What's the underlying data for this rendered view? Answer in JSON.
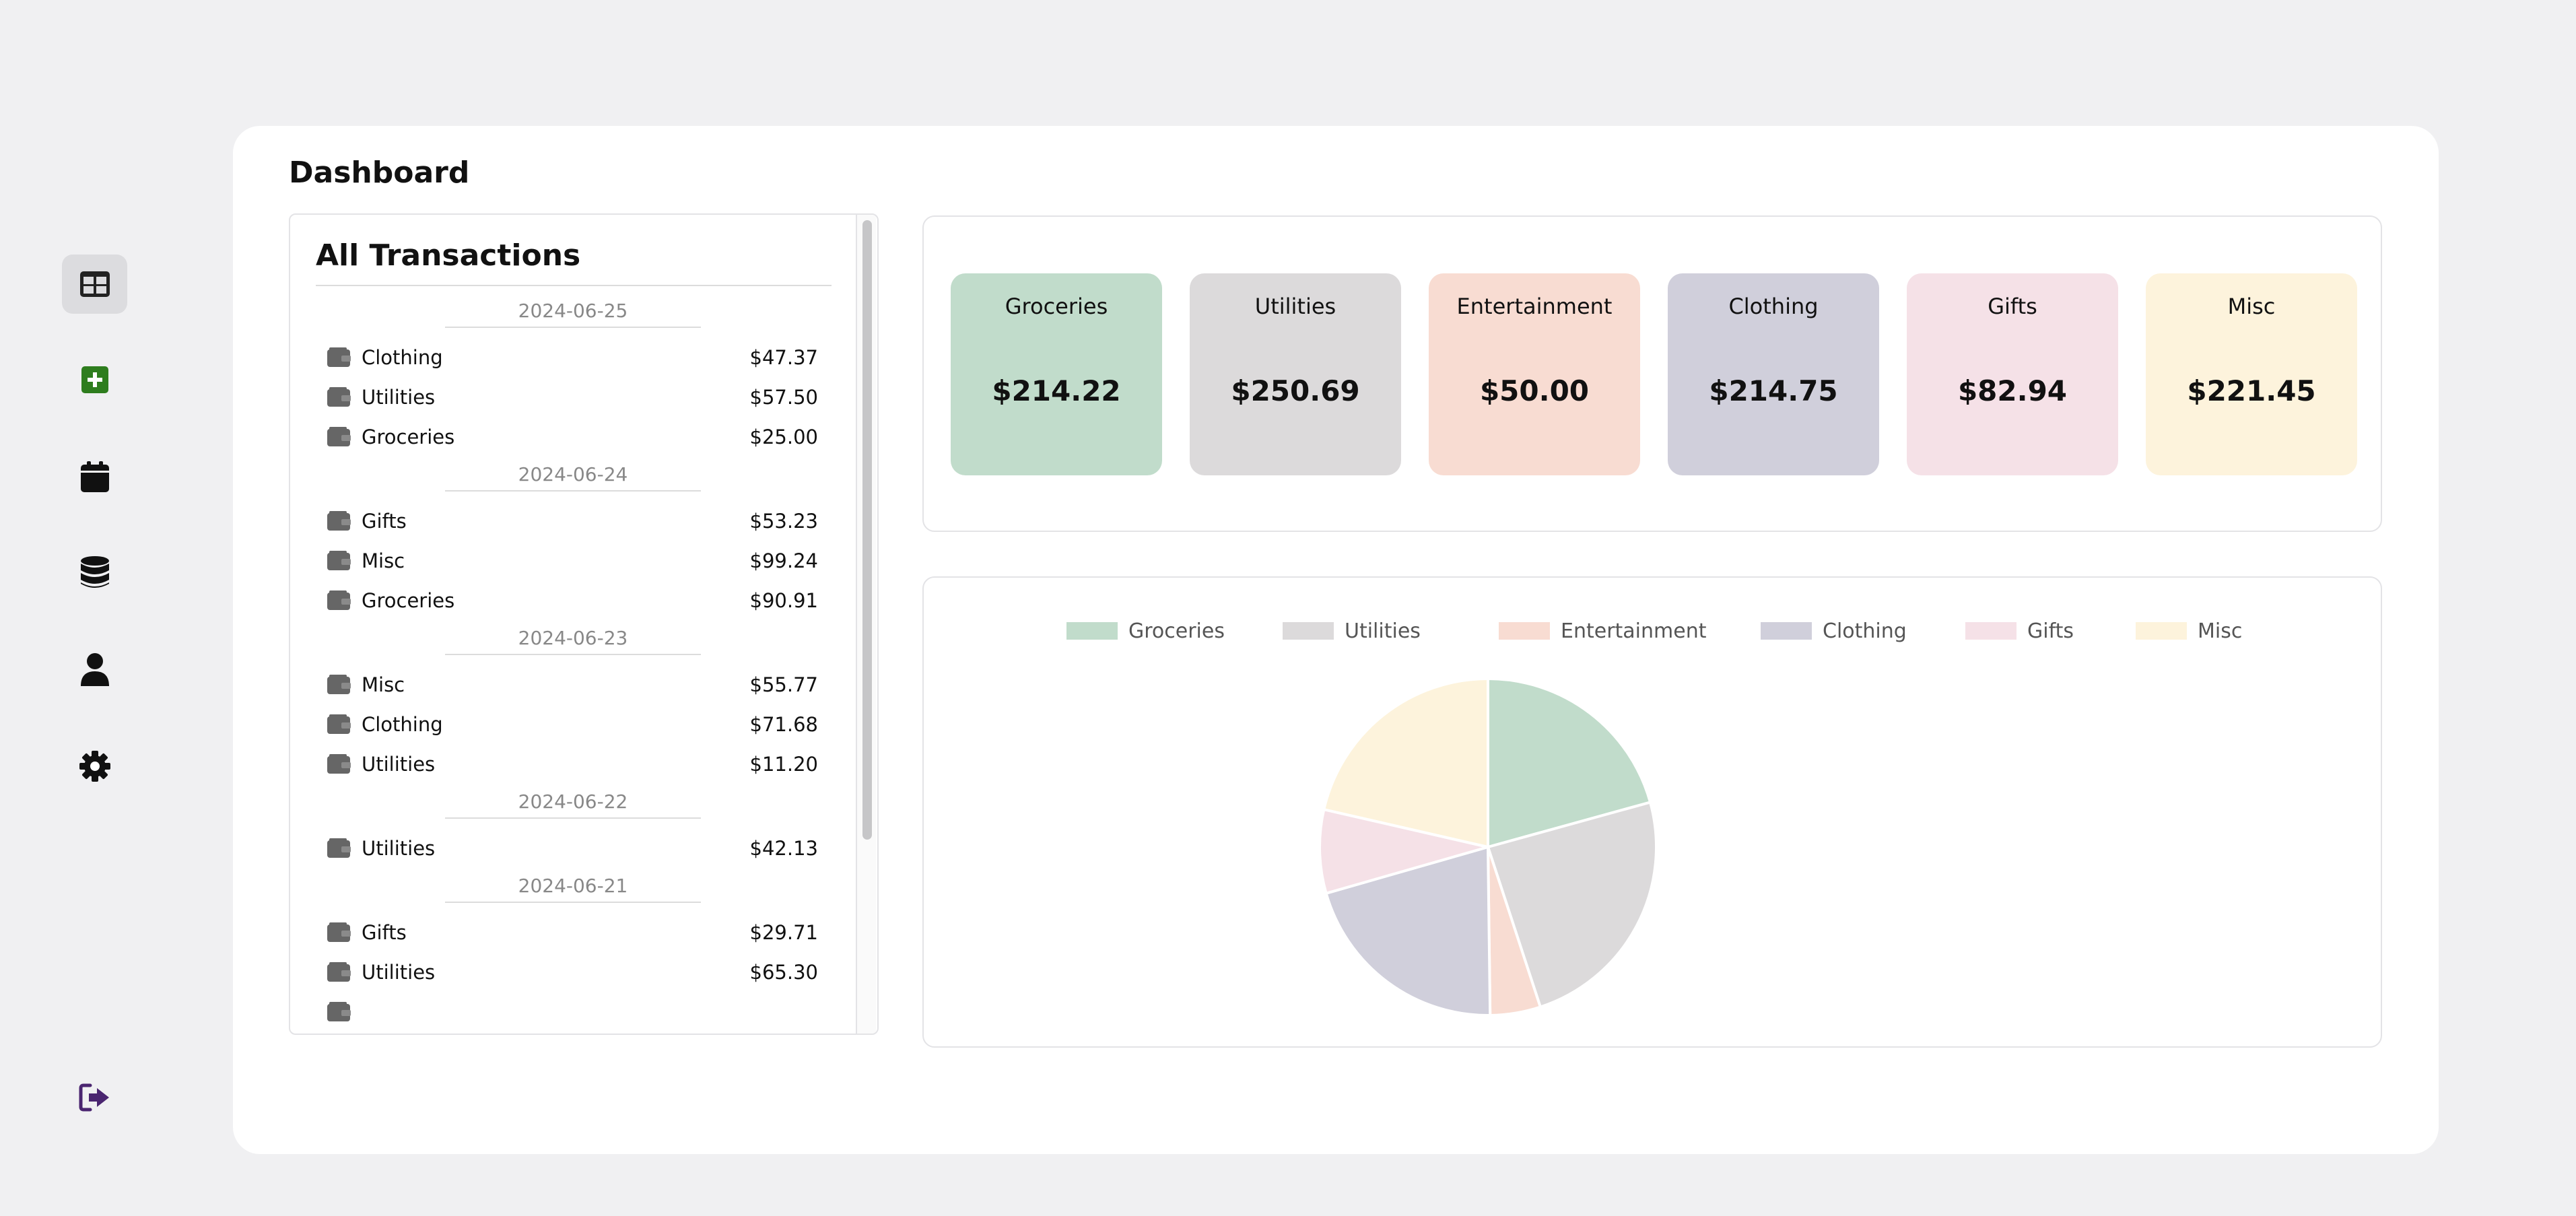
{
  "sidebar": {
    "items": [
      {
        "name": "dashboard",
        "icon": "table-icon",
        "active": true
      },
      {
        "name": "add-transaction",
        "icon": "plus-square-icon",
        "color": "#2e7d1e"
      },
      {
        "name": "calendar",
        "icon": "calendar-icon"
      },
      {
        "name": "database",
        "icon": "database-icon"
      },
      {
        "name": "profile",
        "icon": "user-icon"
      },
      {
        "name": "settings",
        "icon": "gear-icon"
      }
    ],
    "logout": {
      "icon": "logout-icon",
      "color": "#4a2570"
    }
  },
  "page": {
    "title": "Dashboard"
  },
  "transactions": {
    "heading": "All Transactions",
    "groups": [
      {
        "date": "2024-06-25",
        "items": [
          {
            "category": "Clothing",
            "amount": "$47.37"
          },
          {
            "category": "Utilities",
            "amount": "$57.50"
          },
          {
            "category": "Groceries",
            "amount": "$25.00"
          }
        ]
      },
      {
        "date": "2024-06-24",
        "items": [
          {
            "category": "Gifts",
            "amount": "$53.23"
          },
          {
            "category": "Misc",
            "amount": "$99.24"
          },
          {
            "category": "Groceries",
            "amount": "$90.91"
          }
        ]
      },
      {
        "date": "2024-06-23",
        "items": [
          {
            "category": "Misc",
            "amount": "$55.77"
          },
          {
            "category": "Clothing",
            "amount": "$71.68"
          },
          {
            "category": "Utilities",
            "amount": "$11.20"
          }
        ]
      },
      {
        "date": "2024-06-22",
        "items": [
          {
            "category": "Utilities",
            "amount": "$42.13"
          }
        ]
      },
      {
        "date": "2024-06-21",
        "items": [
          {
            "category": "Gifts",
            "amount": "$29.71"
          },
          {
            "category": "Utilities",
            "amount": "$65.30"
          },
          {
            "category": "",
            "amount": ""
          }
        ]
      }
    ]
  },
  "summary": {
    "cards": [
      {
        "name": "Groceries",
        "total": "$214.22",
        "color": "#c1dccb"
      },
      {
        "name": "Utilities",
        "total": "$250.69",
        "color": "#dcdadb"
      },
      {
        "name": "Entertainment",
        "total": "$50.00",
        "color": "#f8dcd2"
      },
      {
        "name": "Clothing",
        "total": "$214.75",
        "color": "#d0cfdb"
      },
      {
        "name": "Gifts",
        "total": "$82.94",
        "color": "#f5e1e7"
      },
      {
        "name": "Misc",
        "total": "$221.45",
        "color": "#fdf3dc"
      }
    ]
  },
  "chart_data": {
    "type": "pie",
    "categories": [
      "Groceries",
      "Utilities",
      "Entertainment",
      "Clothing",
      "Gifts",
      "Misc"
    ],
    "values": [
      214.22,
      250.69,
      50.0,
      214.75,
      82.94,
      221.45
    ],
    "colors": [
      "#c1dccb",
      "#dcdadb",
      "#f8dcd2",
      "#d0cfdb",
      "#f5e1e7",
      "#fdf3dc"
    ],
    "legend": "top"
  }
}
